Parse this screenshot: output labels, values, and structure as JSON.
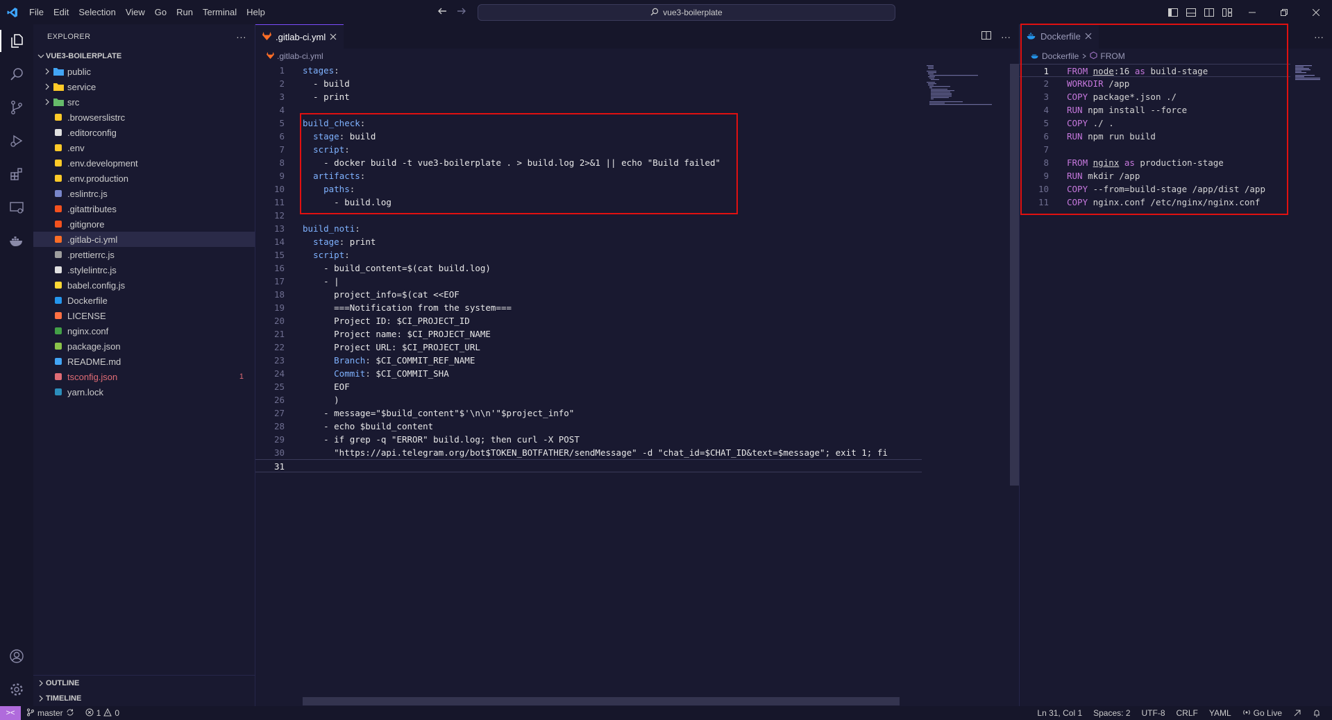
{
  "menu": [
    "File",
    "Edit",
    "Selection",
    "View",
    "Go",
    "Run",
    "Terminal",
    "Help"
  ],
  "command_center": "vue3-boilerplate",
  "sidebar": {
    "title": "EXPLORER",
    "project": "VUE3-BOILERPLATE",
    "items": [
      {
        "label": "public",
        "type": "folder",
        "icon": "folder-blue-icon",
        "color": "#42a5f5"
      },
      {
        "label": "service",
        "type": "folder",
        "icon": "folder-yellow-icon",
        "color": "#ffca28"
      },
      {
        "label": "src",
        "type": "folder",
        "icon": "folder-green-icon",
        "color": "#66bb6a"
      },
      {
        "label": ".browserslistrc",
        "type": "file",
        "icon": "browserslist-icon",
        "color": "#ffca28"
      },
      {
        "label": ".editorconfig",
        "type": "file",
        "icon": "editorconfig-icon",
        "color": "#e0e0e0"
      },
      {
        "label": ".env",
        "type": "file",
        "icon": "env-icon",
        "color": "#ffca28"
      },
      {
        "label": ".env.development",
        "type": "file",
        "icon": "env-icon",
        "color": "#ffca28"
      },
      {
        "label": ".env.production",
        "type": "file",
        "icon": "env-icon",
        "color": "#ffca28"
      },
      {
        "label": ".eslintrc.js",
        "type": "file",
        "icon": "eslint-icon",
        "color": "#7986cb"
      },
      {
        "label": ".gitattributes",
        "type": "file",
        "icon": "git-icon",
        "color": "#f4511e"
      },
      {
        "label": ".gitignore",
        "type": "file",
        "icon": "git-icon",
        "color": "#f4511e"
      },
      {
        "label": ".gitlab-ci.yml",
        "type": "file",
        "icon": "gitlab-icon",
        "color": "#fc6d26",
        "selected": true
      },
      {
        "label": ".prettierrc.js",
        "type": "file",
        "icon": "prettier-icon",
        "color": "#9e9e9e"
      },
      {
        "label": ".stylelintrc.js",
        "type": "file",
        "icon": "stylelint-icon",
        "color": "#e0e0e0"
      },
      {
        "label": "babel.config.js",
        "type": "file",
        "icon": "babel-icon",
        "color": "#fdd835"
      },
      {
        "label": "Dockerfile",
        "type": "file",
        "icon": "docker-icon",
        "color": "#2496ed"
      },
      {
        "label": "LICENSE",
        "type": "file",
        "icon": "license-icon",
        "color": "#ff7043"
      },
      {
        "label": "nginx.conf",
        "type": "file",
        "icon": "nginx-icon",
        "color": "#43a047"
      },
      {
        "label": "package.json",
        "type": "file",
        "icon": "npm-icon",
        "color": "#8bc34a"
      },
      {
        "label": "README.md",
        "type": "file",
        "icon": "info-icon",
        "color": "#42a5f5"
      },
      {
        "label": "tsconfig.json",
        "type": "file",
        "icon": "tsconfig-icon",
        "color": "#e06c75",
        "error": true,
        "badge": "1"
      },
      {
        "label": "yarn.lock",
        "type": "file",
        "icon": "yarn-icon",
        "color": "#2c8ebb"
      }
    ],
    "outline": "OUTLINE",
    "timeline": "TIMELINE"
  },
  "editor1": {
    "tab": ".gitlab-ci.yml",
    "breadcrumb": ".gitlab-ci.yml",
    "current_line": 31,
    "lines": [
      "stages:",
      "  - build",
      "  - print",
      "",
      "build_check:",
      "  stage: build",
      "  script:",
      "    - docker build -t vue3-boilerplate . > build.log 2>&1 || echo \"Build failed\"",
      "  artifacts:",
      "    paths:",
      "      - build.log",
      "",
      "build_noti:",
      "  stage: print",
      "  script:",
      "    - build_content=$(cat build.log)",
      "    - |",
      "      project_info=$(cat <<EOF",
      "      ===Notification from the system===",
      "      Project ID: $CI_PROJECT_ID",
      "      Project name: $CI_PROJECT_NAME",
      "      Project URL: $CI_PROJECT_URL",
      "      Branch: $CI_COMMIT_REF_NAME",
      "      Commit: $CI_COMMIT_SHA",
      "      EOF",
      "      )",
      "    - message=\"$build_content\"$'\\n\\n'\"$project_info\"",
      "    - echo $build_content",
      "    - if grep -q \"ERROR\" build.log; then curl -X POST",
      "      \"https://api.telegram.org/bot$TOKEN_BOTFATHER/sendMessage\" -d \"chat_id=$CHAT_ID&text=$message\"; exit 1; fi",
      ""
    ]
  },
  "editor2": {
    "tab": "Dockerfile",
    "breadcrumb_file": "Dockerfile",
    "breadcrumb_symbol": "FROM",
    "current_line": 1,
    "lines": [
      "FROM node:16 as build-stage",
      "WORKDIR /app",
      "COPY package*.json ./",
      "RUN npm install --force",
      "COPY ./ .",
      "RUN npm run build",
      "",
      "FROM nginx as production-stage",
      "RUN mkdir /app",
      "COPY --from=build-stage /app/dist /app",
      "COPY nginx.conf /etc/nginx/nginx.conf"
    ]
  },
  "statusbar": {
    "branch": "master",
    "errors": "1",
    "warnings": "0",
    "position": "Ln 31, Col 1",
    "spaces": "Spaces: 2",
    "encoding": "UTF-8",
    "eol": "CRLF",
    "language": "YAML",
    "golive": "Go Live"
  }
}
